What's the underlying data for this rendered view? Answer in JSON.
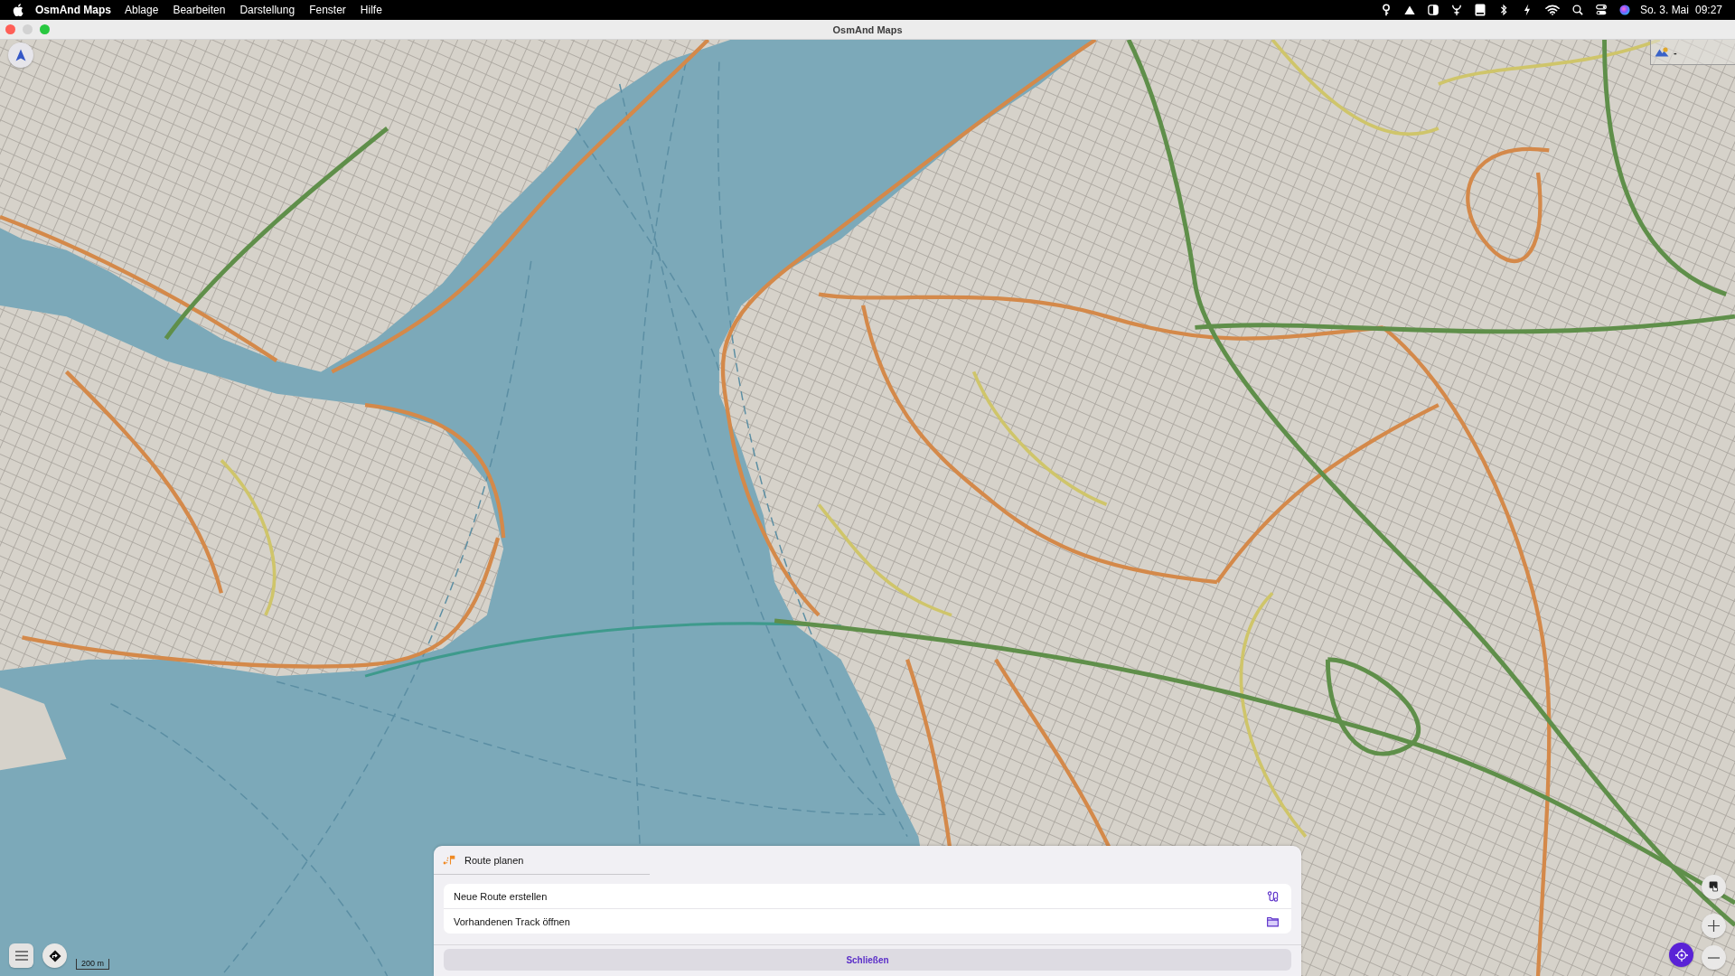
{
  "menu_bar": {
    "app_name": "OsmAnd Maps",
    "menus": [
      "Ablage",
      "Bearbeiten",
      "Darstellung",
      "Fenster",
      "Hilfe"
    ],
    "date": "So. 3. Mai",
    "time": "09:27"
  },
  "window": {
    "title": "OsmAnd Maps",
    "controls": [
      {
        "kind": "close",
        "disabled": false
      },
      {
        "kind": "minimize",
        "disabled": true
      },
      {
        "kind": "zoom",
        "disabled": false
      }
    ]
  },
  "map": {
    "altitude_widget": {
      "value": "-"
    },
    "scale": "200 m"
  },
  "route_sheet": {
    "title": "Route planen",
    "items": [
      {
        "kind": "route",
        "label": "Neue Route erstellen"
      },
      {
        "kind": "folder",
        "label": "Vorhandenen Track öffnen"
      }
    ],
    "close_button": "Schließen"
  }
}
